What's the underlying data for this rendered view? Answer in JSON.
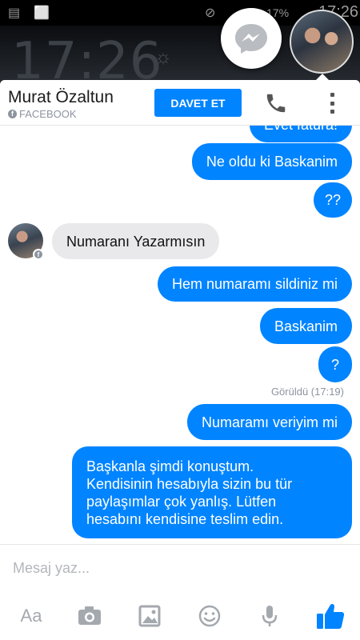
{
  "statusbar": {
    "battery": "17%",
    "time": "17:26"
  },
  "lockscreen": {
    "clock": "17:26"
  },
  "header": {
    "contact_name": "Murat Özaltun",
    "contact_source": "FACEBOOK",
    "invite_label": "DAVET ET"
  },
  "messages": [
    {
      "side": "out",
      "text": "Evet fatura!"
    },
    {
      "side": "out",
      "text": "Ne oldu ki Baskanim"
    },
    {
      "side": "out",
      "text": "??"
    },
    {
      "side": "in",
      "text": "Numaranı Yazarmısın"
    },
    {
      "side": "out",
      "text": "Hem numaramı sildiniz mi"
    },
    {
      "side": "out",
      "text": "Baskanim"
    },
    {
      "side": "out",
      "text": "?"
    },
    {
      "side": "out",
      "text": "Numaramı veriyim mi"
    },
    {
      "side": "out",
      "text": "Başkanla şimdi konuştum.\nKendisinin hesabıyla sizin bu tür\npaylaşımlar çok yanlış. Lütfen\nhesabını kendisine teslim edin."
    }
  ],
  "seen_label": "Görüldü (17:19)",
  "composer": {
    "placeholder": "Mesaj yaz...",
    "aa_label": "Aa"
  },
  "colors": {
    "accent": "#0084ff",
    "incoming_bubble": "#e9e9eb",
    "like": "#0084ff"
  },
  "icons": [
    "messenger-icon",
    "call-icon",
    "more-vertical-icon",
    "camera-icon",
    "image-icon",
    "emoji-icon",
    "microphone-icon",
    "thumbs-up-icon"
  ]
}
